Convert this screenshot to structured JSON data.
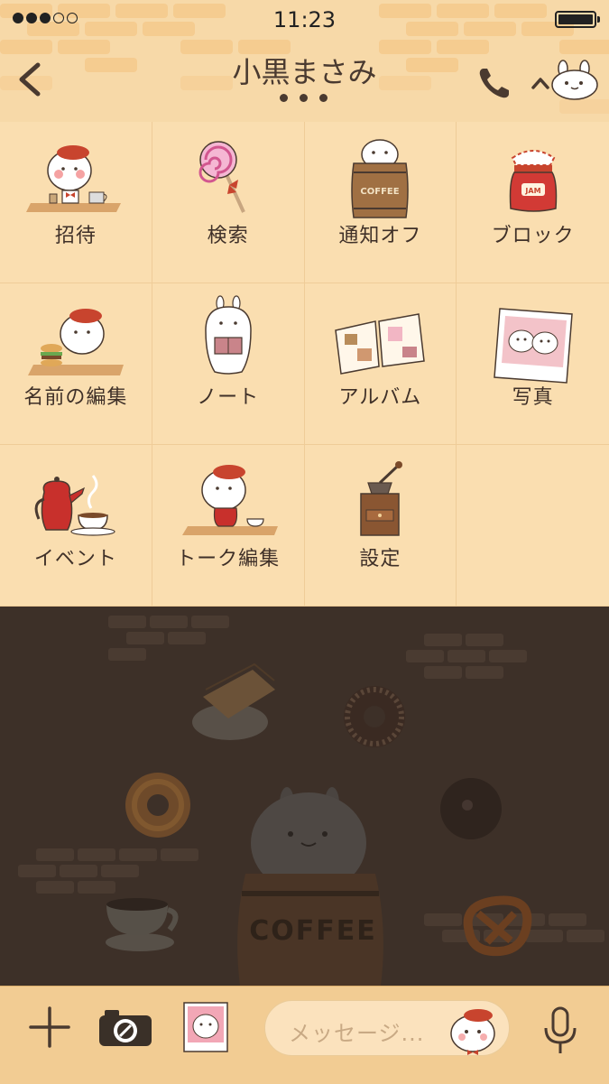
{
  "status_bar": {
    "time": "11:23"
  },
  "header": {
    "title": "小黒まさみ"
  },
  "menu": {
    "items": [
      {
        "label": "招待",
        "icon": "mascot-cafe-icon"
      },
      {
        "label": "検索",
        "icon": "lollipop-icon"
      },
      {
        "label": "通知オフ",
        "icon": "coffee-barrel-icon"
      },
      {
        "label": "ブロック",
        "icon": "jam-jar-icon"
      },
      {
        "label": "名前の編集",
        "icon": "mascot-burger-icon"
      },
      {
        "label": "ノート",
        "icon": "mascot-reading-icon"
      },
      {
        "label": "アルバム",
        "icon": "photo-album-icon"
      },
      {
        "label": "写真",
        "icon": "polaroid-icon"
      },
      {
        "label": "イベント",
        "icon": "teapot-icon"
      },
      {
        "label": "トーク編集",
        "icon": "mascot-tea-icon"
      },
      {
        "label": "設定",
        "icon": "coffee-grinder-icon"
      }
    ]
  },
  "chat_background": {
    "barrel_text": "COFFEE"
  },
  "input_bar": {
    "placeholder": "メッセージ..."
  }
}
